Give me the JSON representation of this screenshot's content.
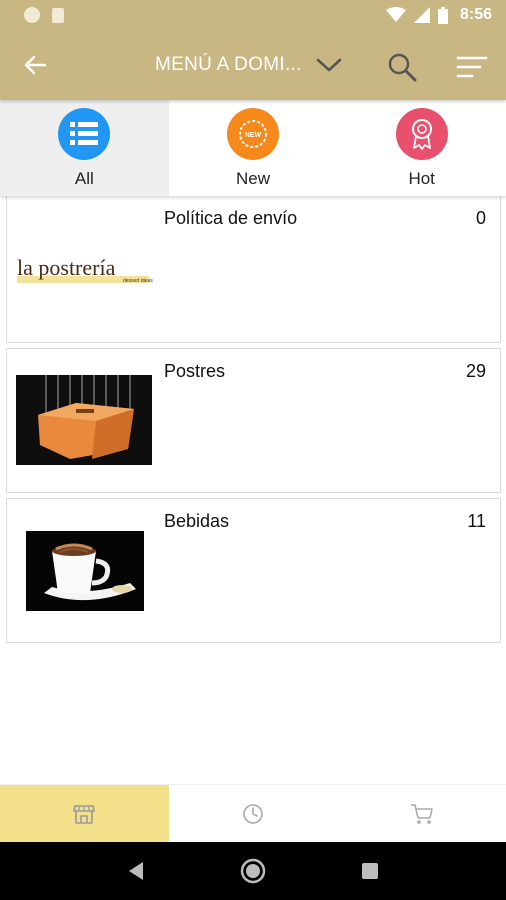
{
  "status_bar": {
    "time": "8:56"
  },
  "app_bar": {
    "title": "MENÚ A DOMI..."
  },
  "tabs": [
    {
      "label": "All",
      "color": "#2196f3",
      "icon": "list-icon",
      "active": true
    },
    {
      "label": "New",
      "color": "#f5891c",
      "icon": "new-badge-icon",
      "badge_text": "NEW"
    },
    {
      "label": "Hot",
      "color": "#e8506d",
      "icon": "award-ribbon-icon"
    }
  ],
  "categories": [
    {
      "name": "Política de envío",
      "count": "0",
      "image": "la-postreria-logo",
      "logo_text": "la postrería",
      "logo_sub": "dessert ideas"
    },
    {
      "name": "Postres",
      "count": "29",
      "image": "cake-photo"
    },
    {
      "name": "Bebidas",
      "count": "11",
      "image": "coffee-cup-photo"
    }
  ],
  "bottom_nav": [
    {
      "icon": "store-icon",
      "active": true
    },
    {
      "icon": "clock-icon"
    },
    {
      "icon": "cart-icon"
    }
  ],
  "colors": {
    "primary": "#c9b783",
    "active_nav": "#f2e08a"
  }
}
